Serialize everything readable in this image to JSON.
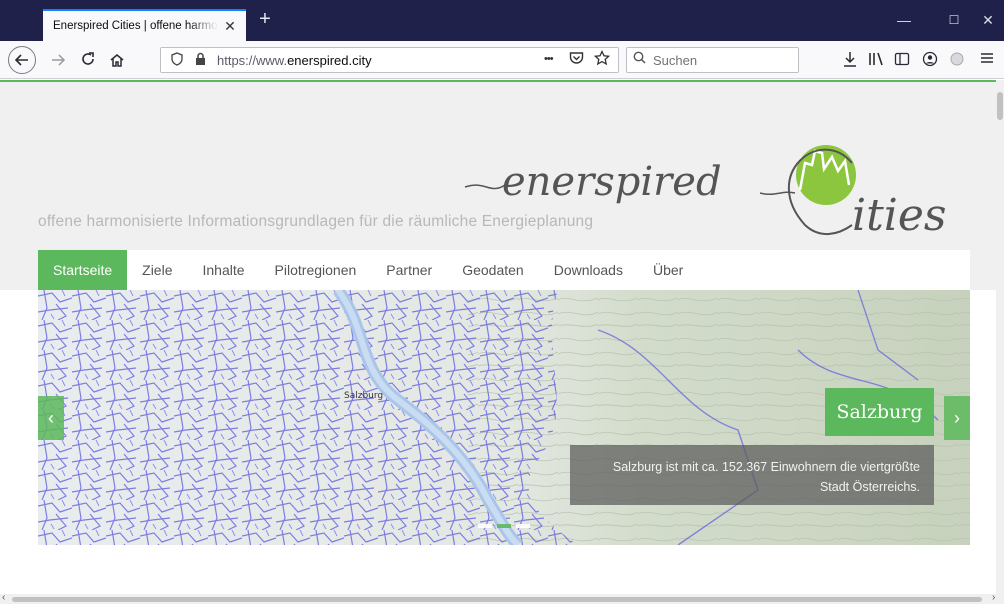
{
  "browser": {
    "tab_title": "Enerspired Cities | offene harmonisierte Informationsgrundlagen",
    "tab_close": "✕",
    "new_tab": "+",
    "url_domain_prefix": "https://www.",
    "url_domain": "enerspired.city",
    "page_actions": "•••",
    "search_placeholder": "Suchen",
    "window_controls": {
      "minimize": "—",
      "maximize": "☐",
      "close": "✕"
    }
  },
  "site": {
    "tagline": "offene harmonisierte Informationsgrundlagen für die räumliche Energieplanung",
    "logo_text_left": "enerspired",
    "logo_text_right": "ities",
    "nav": [
      {
        "label": "Startseite",
        "active": true
      },
      {
        "label": "Ziele"
      },
      {
        "label": "Inhalte"
      },
      {
        "label": "Pilotregionen"
      },
      {
        "label": "Partner"
      },
      {
        "label": "Geodaten"
      },
      {
        "label": "Downloads"
      },
      {
        "label": "Über"
      }
    ],
    "carousel": {
      "title": "Salzburg",
      "text_line1": "Salzburg ist mit ca. 152.367 Einwohnern die viertgrößte",
      "text_line2": "Stadt Österreichs.",
      "prev": "‹",
      "next": "›",
      "slide_count": 3,
      "active_slide": 2,
      "map_labels": {
        "city": "Salzburg"
      }
    },
    "accent_color": "#5cb85c"
  }
}
